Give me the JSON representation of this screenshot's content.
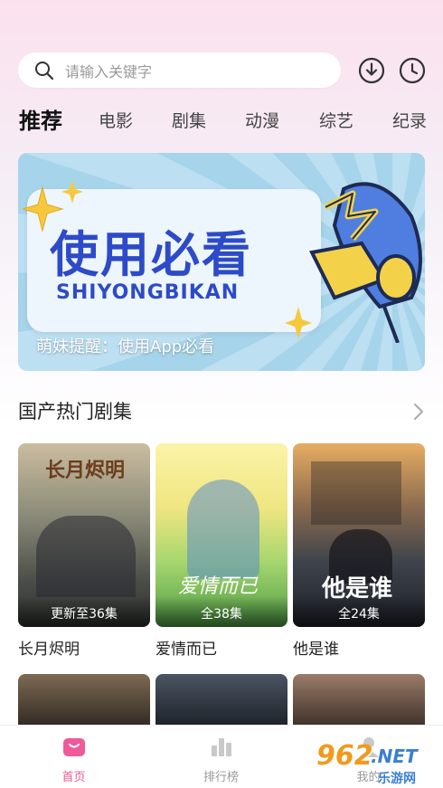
{
  "search": {
    "placeholder": "请输入关键字"
  },
  "header_icons": [
    "download-icon",
    "history-icon"
  ],
  "tabs": [
    {
      "label": "推荐",
      "active": true
    },
    {
      "label": "电影"
    },
    {
      "label": "剧集"
    },
    {
      "label": "动漫"
    },
    {
      "label": "综艺"
    },
    {
      "label": "纪录"
    }
  ],
  "banner": {
    "title": "使用必看",
    "subtitle": "SHIYONGBIKAN",
    "caption": "萌妹提醒：使用App必看"
  },
  "section": {
    "title": "国产热门剧集"
  },
  "shows": [
    {
      "title": "长月烬明",
      "status": "更新至36集",
      "colors": [
        "#c9b89a",
        "#6f7566",
        "#3a3f3a"
      ]
    },
    {
      "title": "爱情而已",
      "status": "全38集",
      "colors": [
        "#f7e87a",
        "#9fd36a",
        "#3f8c3a"
      ]
    },
    {
      "title": "他是谁",
      "status": "全24集",
      "colors": [
        "#e0a15a",
        "#5a5f6a",
        "#1e2228"
      ]
    }
  ],
  "row2_colors": [
    [
      "#6b5a45",
      "#2e2822"
    ],
    [
      "#3d4552",
      "#1c2027"
    ],
    [
      "#8a6f5e",
      "#3a2e28"
    ]
  ],
  "bottom_nav": [
    {
      "label": "首页",
      "icon": "home-icon",
      "active": true
    },
    {
      "label": "排行榜",
      "icon": "ranking-icon"
    },
    {
      "label": "我的",
      "icon": "profile-icon"
    }
  ],
  "watermark": {
    "brand": "962",
    "suffix": ".NET",
    "sub": "乐游网"
  },
  "colors": {
    "accent": "#ef5a9a",
    "banner_text": "#2d4bc8"
  }
}
